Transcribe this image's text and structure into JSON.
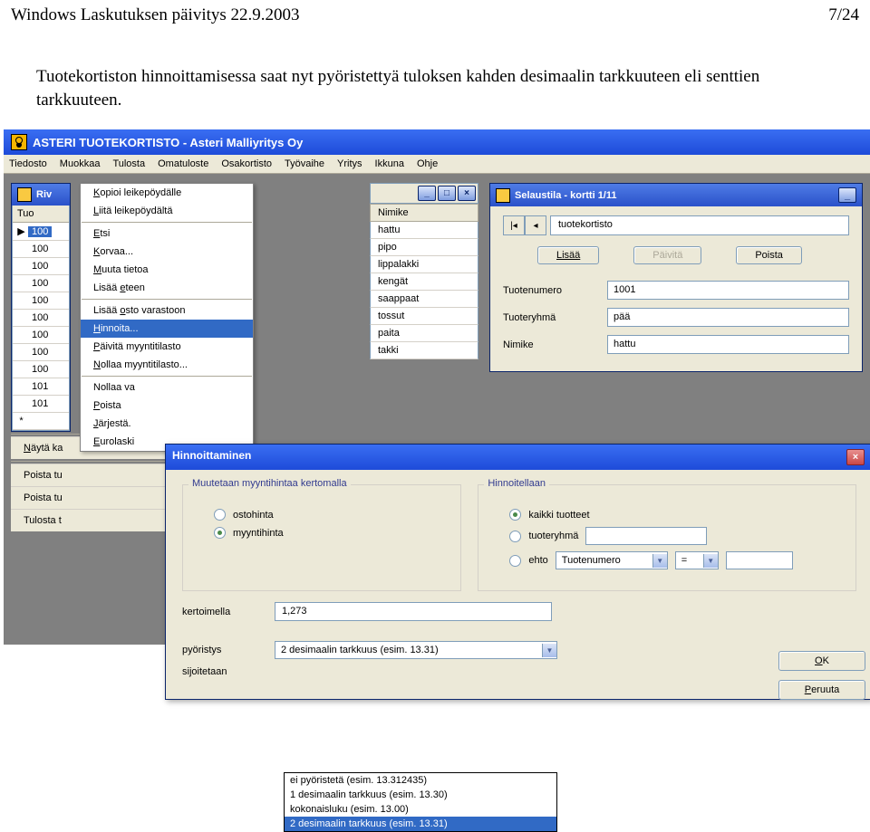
{
  "header": {
    "left": "Windows Laskutuksen päivitys 22.9.2003",
    "right": "7/24"
  },
  "description": "Tuotekortiston hinnoittamisessa saat nyt pyöristettyä tuloksen kahden desimaalin tarkkuuteen eli senttien tarkkuuteen.",
  "app": {
    "title": "ASTERI TUOTEKORTISTO - Asteri Malliyritys Oy",
    "menus": [
      "Tiedosto",
      "Muokkaa",
      "Tulosta",
      "Omatuloste",
      "Osakortisto",
      "Työvaihe",
      "Yritys",
      "Ikkuna",
      "Ohje"
    ]
  },
  "grid": {
    "win_title": "Riv",
    "col_header": "Tuo",
    "rows": [
      "100",
      "100",
      "100",
      "100",
      "100",
      "100",
      "100",
      "100",
      "100",
      "101",
      "101"
    ],
    "selected_index": 0
  },
  "context_menu": {
    "items": [
      {
        "label": "Kopioi leikepöydälle",
        "u": 0
      },
      {
        "label": "Liitä leikepöydältä",
        "u": 0
      },
      {
        "label": "Etsi",
        "u": 0
      },
      {
        "label": "Korvaa...",
        "u": 0
      },
      {
        "label": "Muuta tietoa",
        "u": 0
      },
      {
        "label": "Lisää eteen",
        "u": 6
      },
      {
        "label": "Lisää osto varastoon",
        "u": 6
      },
      {
        "label": "Hinnoita...",
        "u": 0,
        "selected": true
      },
      {
        "label": "Päivitä myyntitilasto",
        "u": 0
      },
      {
        "label": "Nollaa myyntitilasto...",
        "u": 0
      },
      {
        "label": "Nollaa va",
        "u": -1
      },
      {
        "label": "Poista",
        "u": 0
      },
      {
        "label": "Järjestä.",
        "u": 0
      },
      {
        "label": "Eurolaski",
        "u": 0
      }
    ],
    "after_sep": [
      {
        "label": "Näytä ka",
        "u": 0
      },
      {
        "label": "Poista tu",
        "u": -1
      },
      {
        "label": "Poista tu",
        "u": -1
      },
      {
        "label": "Tulosta t",
        "u": -1
      }
    ]
  },
  "nimike": {
    "header": "Nimike",
    "items": [
      "hattu",
      "pipo",
      "lippalakki",
      "kengät",
      "saappaat",
      "tossut",
      "paita",
      "takki"
    ]
  },
  "browse": {
    "title": "Selaustila - kortti 1/11",
    "nav_text": "tuotekortisto",
    "btn_add": "Lisää",
    "btn_upd": "Päivitä",
    "btn_del": "Poista",
    "fields": [
      {
        "label": "Tuotenumero",
        "value": "1001"
      },
      {
        "label": "Tuoteryhmä",
        "value": "pää"
      },
      {
        "label": "Nimike",
        "value": "hattu"
      }
    ]
  },
  "dialog": {
    "title": "Hinnoittaminen",
    "grp1_label": "Muutetaan myyntihintaa kertomalla",
    "grp1_opts": [
      "ostohinta",
      "myyntihinta"
    ],
    "grp1_sel": 1,
    "grp2_label": "Hinnoitellaan",
    "grp2_opts": [
      "kaikki tuotteet",
      "tuoteryhmä",
      "ehto"
    ],
    "grp2_sel": 0,
    "ehto_field": "Tuotenumero",
    "ehto_op": "=",
    "kerroin_label": "kertoimella",
    "kerroin_val": "1,273",
    "pyoristys_label": "pyöristys",
    "pyoristys_val": "2 desimaalin tarkkuus (esim. 13.31)",
    "sij_label": "sijoitetaan",
    "dd_opts": [
      "ei pyöristetä (esim. 13.312435)",
      "1 desimaalin tarkkuus (esim. 13.30)",
      "kokonaisluku (esim. 13.00)",
      "2 desimaalin tarkkuus (esim. 13.31)"
    ],
    "dd_sel": 3,
    "ok": "OK",
    "cancel": "Peruuta"
  }
}
